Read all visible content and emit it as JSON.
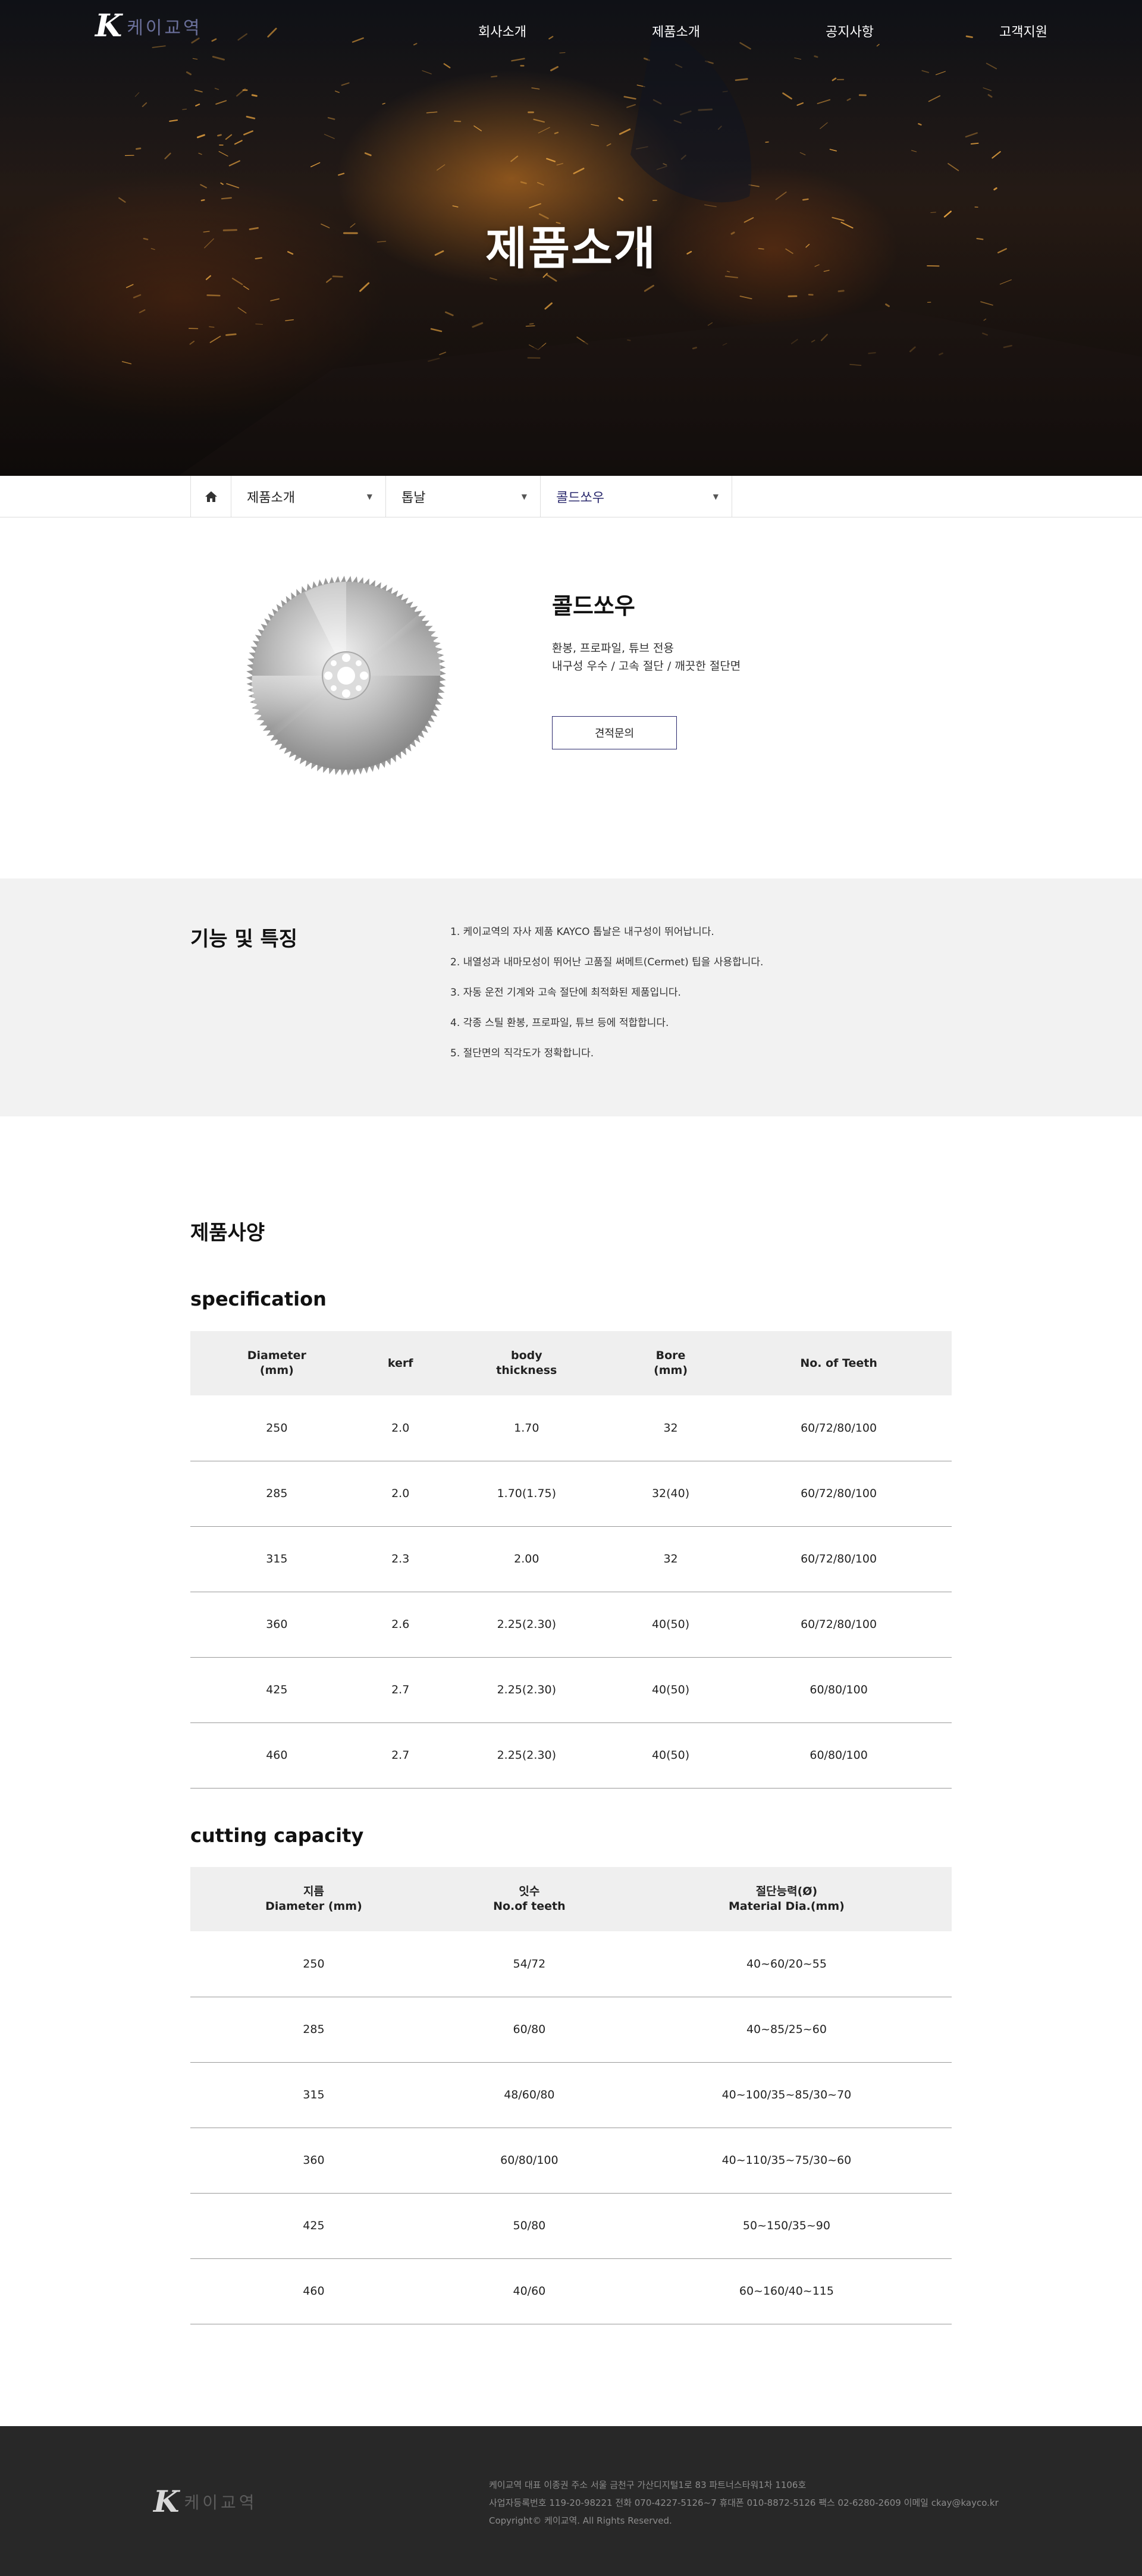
{
  "header": {
    "logo_k": "K",
    "logo_text": "케이교역",
    "nav": [
      "회사소개",
      "제품소개",
      "공지사항",
      "고객지원"
    ]
  },
  "hero": {
    "title": "제품소개"
  },
  "breadcrumb": {
    "home_icon": "home-icon",
    "items": [
      "제품소개",
      "톱날",
      "콜드쏘우"
    ]
  },
  "product": {
    "name": "콜드쏘우",
    "desc": [
      "환봉, 프로파일, 튜브 전용",
      "내구성 우수 / 고속 절단 / 깨끗한 절단면"
    ],
    "quote_button": "견적문의"
  },
  "features": {
    "title": "기능 및 특징",
    "items": [
      "1. 케이교역의 자사 제품 KAYCO 톱날은 내구성이 뛰어납니다.",
      "2. 내열성과 내마모성이 뛰어난 고품질 써메트(Cermet) 팁을 사용합니다.",
      "3. 자동 운전 기계와 고속 절단에 최적화된 제품입니다.",
      "4. 각종 스틸 환봉, 프로파일, 튜브 등에 적합합니다.",
      "5. 절단면의 직각도가 정확합니다."
    ]
  },
  "spec": {
    "title": "제품사양",
    "specification": {
      "title": "specification",
      "headers": [
        [
          "Diameter",
          "(mm)"
        ],
        [
          "kerf"
        ],
        [
          "body",
          "thickness"
        ],
        [
          "Bore",
          "(mm)"
        ],
        [
          "No. of Teeth"
        ]
      ],
      "rows": [
        [
          "250",
          "2.0",
          "1.70",
          "32",
          "60/72/80/100"
        ],
        [
          "285",
          "2.0",
          "1.70(1.75)",
          "32(40)",
          "60/72/80/100"
        ],
        [
          "315",
          "2.3",
          "2.00",
          "32",
          "60/72/80/100"
        ],
        [
          "360",
          "2.6",
          "2.25(2.30)",
          "40(50)",
          "60/72/80/100"
        ],
        [
          "425",
          "2.7",
          "2.25(2.30)",
          "40(50)",
          "60/80/100"
        ],
        [
          "460",
          "2.7",
          "2.25(2.30)",
          "40(50)",
          "60/80/100"
        ]
      ]
    },
    "capacity": {
      "title": "cutting capacity",
      "headers": [
        [
          "지름",
          "Diameter (mm)"
        ],
        [
          "잇수",
          "No.of teeth"
        ],
        [
          "절단능력(Ø)",
          "Material Dia.(mm)"
        ]
      ],
      "rows": [
        [
          "250",
          "54/72",
          "40~60/20~55"
        ],
        [
          "285",
          "60/80",
          "40~85/25~60"
        ],
        [
          "315",
          "48/60/80",
          "40~100/35~85/30~70"
        ],
        [
          "360",
          "60/80/100",
          "40~110/35~75/30~60"
        ],
        [
          "425",
          "50/80",
          "50~150/35~90"
        ],
        [
          "460",
          "40/60",
          "60~160/40~115"
        ]
      ]
    }
  },
  "footer": {
    "logo_k": "K",
    "logo_text": "케이교역",
    "lines": [
      "케이교역   대표 이종권   주소 서울 금천구 가산디지털1로 83 파트너스타워1차 1106호",
      "사업자등록번호 119-20-98221   전화 070-4227-5126~7   휴대폰 010-8872-5126   팩스 02-6280-2609   이메일 ckay@kayco.kr",
      "Copyright© 케이교역. All Rights Reserved."
    ]
  }
}
